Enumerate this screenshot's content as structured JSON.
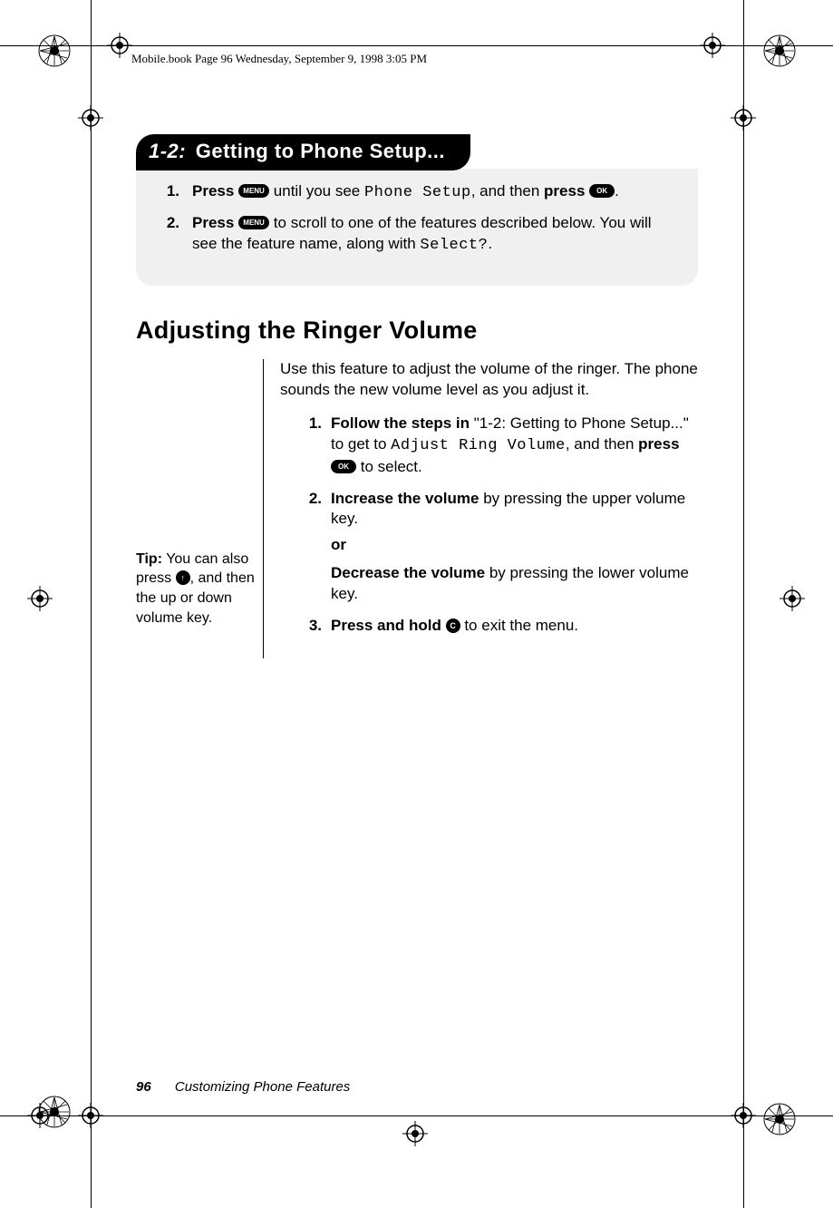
{
  "header_run": "Mobile.book  Page 96  Wednesday, September 9, 1998  3:05 PM",
  "pill": {
    "lead": "1-2:",
    "title": "Getting to Phone Setup..."
  },
  "steps12": [
    {
      "num": "1.",
      "press": "Press",
      "key1": "MENU",
      "mid1": " until you see ",
      "lcd": "Phone Setup",
      "mid2": ", and then ",
      "press2": "press",
      "key2": "OK",
      "tail": "."
    },
    {
      "num": "2.",
      "press": "Press",
      "key1": "MENU",
      "mid1": " to scroll to one of the features described below. You will see the feature name, along with ",
      "lcd": "Select?",
      "tail": "."
    }
  ],
  "section_title": "Adjusting the Ringer Volume",
  "intro": "Use this feature to adjust the volume of the ringer. The phone sounds the new volume level as you adjust it.",
  "tip": {
    "label": "Tip:",
    "t1": " You can also press ",
    "key": "↑",
    "t2": ", and then the up or down volume key."
  },
  "substeps": [
    {
      "num": "1.",
      "b1": "Follow the steps in",
      "q": " \"1-2: Getting to Phone Setup...\" to get to ",
      "lcd": "Adjust Ring Volume",
      "mid": ", and then ",
      "b2": "press",
      "key": "OK",
      "tail": " to select."
    },
    {
      "num": "2.",
      "b1": "Increase the volume",
      "t1": " by pressing the upper volume key.",
      "or": "or",
      "b2": "Decrease the volume",
      "t2": " by pressing the lower volume key."
    },
    {
      "num": "3.",
      "b1": "Press and hold",
      "key": "C",
      "tail": " to exit the menu."
    }
  ],
  "footer": {
    "page": "96",
    "title": "Customizing Phone Features"
  }
}
